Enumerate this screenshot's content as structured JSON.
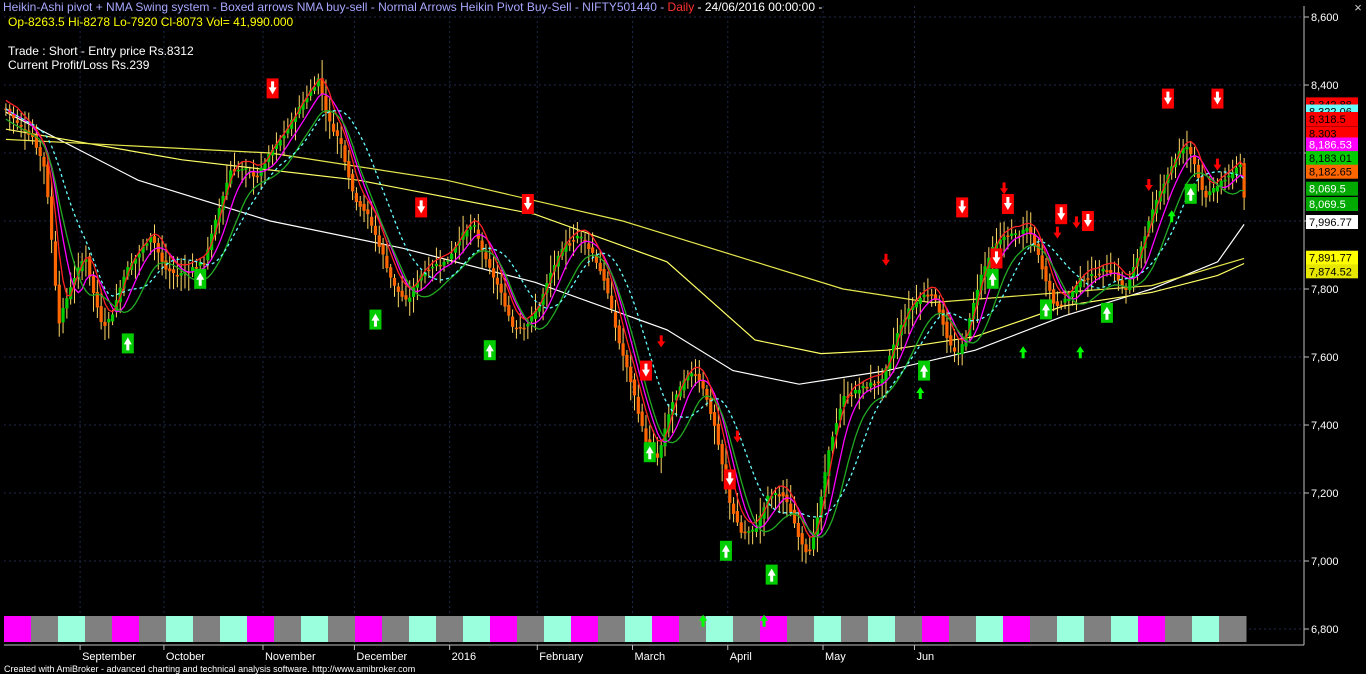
{
  "title": {
    "text": "Heikin-Ashi pivot + NMA Swing system - Boxed arrows NMA buy-sell - Normal Arrows Heikin Pivot Buy-Sell - NIFTY501440 - ",
    "interval": "Daily",
    "timestamp": " - 24/06/2016 00:00:00 -"
  },
  "ohlc_line": "Op-8263.5  Hi-8278  Lo-7920  Cl-8073  Vol= 41,990.000",
  "trade_line": "Trade : Short - Entry price Rs.8312",
  "profit_line": "Current Profit/Loss Rs.239",
  "credit": "Created with AmiBroker - advanced charting and technical analysis software. http://www.amibroker.com",
  "close_icon": "×",
  "colors": {
    "background": "#000000",
    "grid": "#1e2a4a",
    "axis_text": "#ffffff",
    "candle_up": "#00cc00",
    "candle_down": "#ff6600",
    "sell_arrow": "#ff0000",
    "buy_arrow": "#00ff00",
    "ribbon_pink": "#ff00ff",
    "ribbon_mint": "#99ffdd",
    "ribbon_gray": "#808080"
  },
  "chart_data": {
    "type": "candlestick",
    "symbol": "NIFTY501440",
    "interval": "Daily",
    "y_ticks": [
      6800,
      7000,
      7200,
      7400,
      7600,
      7800,
      8000,
      8200,
      8400,
      8600
    ],
    "y_tick_labels": [
      "6,800",
      "7,000",
      "7,200",
      "7,400",
      "7,600",
      "7,800",
      "8,000",
      "8,200",
      "8,400",
      "8,600"
    ],
    "ylim": [
      6760,
      8640
    ],
    "x_months": [
      "September",
      "October",
      "November",
      "December",
      "2016",
      "February",
      "March",
      "April",
      "May",
      "Jun"
    ],
    "price_path": [
      [
        0,
        8330
      ],
      [
        3,
        8280
      ],
      [
        6,
        8250
      ],
      [
        9,
        8150
      ],
      [
        12,
        7700
      ],
      [
        15,
        7820
      ],
      [
        18,
        7900
      ],
      [
        20,
        7780
      ],
      [
        22,
        7690
      ],
      [
        24,
        7720
      ],
      [
        27,
        7850
      ],
      [
        30,
        7900
      ],
      [
        33,
        7960
      ],
      [
        36,
        7860
      ],
      [
        39,
        7840
      ],
      [
        42,
        7860
      ],
      [
        45,
        7880
      ],
      [
        48,
        8020
      ],
      [
        51,
        8150
      ],
      [
        54,
        8150
      ],
      [
        57,
        8130
      ],
      [
        60,
        8200
      ],
      [
        63,
        8250
      ],
      [
        66,
        8320
      ],
      [
        69,
        8380
      ],
      [
        71,
        8420
      ],
      [
        73,
        8300
      ],
      [
        76,
        8230
      ],
      [
        79,
        8070
      ],
      [
        82,
        8020
      ],
      [
        85,
        7920
      ],
      [
        88,
        7810
      ],
      [
        91,
        7760
      ],
      [
        94,
        7840
      ],
      [
        97,
        7870
      ],
      [
        100,
        7880
      ],
      [
        103,
        7950
      ],
      [
        106,
        7990
      ],
      [
        109,
        7880
      ],
      [
        112,
        7800
      ],
      [
        115,
        7690
      ],
      [
        118,
        7690
      ],
      [
        121,
        7750
      ],
      [
        124,
        7860
      ],
      [
        127,
        7930
      ],
      [
        130,
        7960
      ],
      [
        133,
        7910
      ],
      [
        136,
        7820
      ],
      [
        139,
        7650
      ],
      [
        142,
        7520
      ],
      [
        145,
        7360
      ],
      [
        148,
        7300
      ],
      [
        151,
        7460
      ],
      [
        154,
        7530
      ],
      [
        156,
        7560
      ],
      [
        158,
        7520
      ],
      [
        161,
        7390
      ],
      [
        164,
        7180
      ],
      [
        167,
        7080
      ],
      [
        170,
        7090
      ],
      [
        173,
        7190
      ],
      [
        176,
        7200
      ],
      [
        178,
        7150
      ],
      [
        180,
        7070
      ],
      [
        182,
        7020
      ],
      [
        184,
        7110
      ],
      [
        187,
        7340
      ],
      [
        190,
        7480
      ],
      [
        193,
        7500
      ],
      [
        196,
        7520
      ],
      [
        199,
        7530
      ],
      [
        202,
        7660
      ],
      [
        205,
        7740
      ],
      [
        208,
        7780
      ],
      [
        210,
        7790
      ],
      [
        212,
        7730
      ],
      [
        214,
        7640
      ],
      [
        216,
        7600
      ],
      [
        218,
        7670
      ],
      [
        221,
        7830
      ],
      [
        224,
        7920
      ],
      [
        227,
        7960
      ],
      [
        230,
        7960
      ],
      [
        232,
        7980
      ],
      [
        234,
        7910
      ],
      [
        236,
        7830
      ],
      [
        238,
        7750
      ],
      [
        241,
        7770
      ],
      [
        244,
        7830
      ],
      [
        247,
        7840
      ],
      [
        250,
        7860
      ],
      [
        252,
        7840
      ],
      [
        254,
        7790
      ],
      [
        257,
        7900
      ],
      [
        260,
        8020
      ],
      [
        263,
        8120
      ],
      [
        266,
        8200
      ],
      [
        268,
        8220
      ],
      [
        270,
        8160
      ],
      [
        272,
        8070
      ],
      [
        274,
        8090
      ],
      [
        276,
        8120
      ],
      [
        278,
        8130
      ],
      [
        280,
        8180
      ],
      [
        281,
        8073
      ]
    ],
    "emas": [
      {
        "color": "#ffffff",
        "points": [
          [
            0,
            8320
          ],
          [
            30,
            8120
          ],
          [
            60,
            8000
          ],
          [
            90,
            7920
          ],
          [
            120,
            7820
          ],
          [
            150,
            7680
          ],
          [
            165,
            7560
          ],
          [
            180,
            7520
          ],
          [
            200,
            7560
          ],
          [
            220,
            7620
          ],
          [
            240,
            7720
          ],
          [
            260,
            7800
          ],
          [
            275,
            7880
          ],
          [
            281,
            7990
          ]
        ]
      },
      {
        "color": "#ffff66",
        "points": [
          [
            0,
            8270
          ],
          [
            40,
            8180
          ],
          [
            80,
            8120
          ],
          [
            120,
            8020
          ],
          [
            150,
            7880
          ],
          [
            170,
            7650
          ],
          [
            185,
            7610
          ],
          [
            200,
            7620
          ],
          [
            220,
            7660
          ],
          [
            240,
            7750
          ],
          [
            260,
            7790
          ],
          [
            275,
            7840
          ],
          [
            281,
            7875
          ]
        ]
      },
      {
        "color": "#e6e64d",
        "points": [
          [
            0,
            8240
          ],
          [
            60,
            8200
          ],
          [
            100,
            8120
          ],
          [
            140,
            8000
          ],
          [
            170,
            7880
          ],
          [
            190,
            7800
          ],
          [
            210,
            7760
          ],
          [
            240,
            7790
          ],
          [
            260,
            7810
          ],
          [
            281,
            7890
          ]
        ]
      }
    ],
    "right_labels": [
      {
        "value": "8,342.88",
        "price": 8343,
        "bg": "#ff0000",
        "fg": "#000000"
      },
      {
        "value": "8,322.06",
        "price": 8322,
        "bg": "#66ffff",
        "fg": "#000000"
      },
      {
        "value": "8,318.5",
        "price": 8300,
        "bg": "#ff0000",
        "fg": "#000000"
      },
      {
        "value": "8,303",
        "price": 8258,
        "bg": "#ff0000",
        "fg": "#000000"
      },
      {
        "value": "8,186.53",
        "price": 8225,
        "bg": "#ff00ff",
        "fg": "#ffffff"
      },
      {
        "value": "8,183.01",
        "price": 8185,
        "bg": "#00cc00",
        "fg": "#000000"
      },
      {
        "value": "8,182.65",
        "price": 8145,
        "bg": "#ff6600",
        "fg": "#000000"
      },
      {
        "value": "8,069.5",
        "price": 8095,
        "bg": "#00aa00",
        "fg": "#ffffff"
      },
      {
        "value": "8,069.5",
        "price": 8050,
        "bg": "#00aa00",
        "fg": "#ffffff"
      },
      {
        "value": "7,996.77",
        "price": 7997,
        "bg": "#ffffff",
        "fg": "#000000"
      },
      {
        "value": "7,891.77",
        "price": 7892,
        "bg": "#ffff00",
        "fg": "#000000"
      },
      {
        "value": "7,874.52",
        "price": 7852,
        "bg": "#e6e600",
        "fg": "#000000"
      }
    ],
    "sell_boxed": [
      [
        70,
        8390
      ],
      [
        109,
        8040
      ],
      [
        137,
        8050
      ],
      [
        168,
        7560
      ],
      [
        190,
        7240
      ],
      [
        251,
        8040
      ],
      [
        260,
        7890
      ],
      [
        263,
        8050
      ],
      [
        277,
        8020
      ],
      [
        284,
        8000
      ],
      [
        305,
        8360
      ],
      [
        318,
        8360
      ]
    ],
    "buy_boxed": [
      [
        32,
        7640
      ],
      [
        51,
        7830
      ],
      [
        97,
        7710
      ],
      [
        127,
        7620
      ],
      [
        169,
        7320
      ],
      [
        189,
        7030
      ],
      [
        201,
        6960
      ],
      [
        241,
        7560
      ],
      [
        259,
        7830
      ],
      [
        273,
        7740
      ],
      [
        289,
        7730
      ],
      [
        311,
        8080
      ]
    ],
    "sell_plain": [
      [
        172,
        7640
      ],
      [
        192,
        7360
      ],
      [
        231,
        7880
      ],
      [
        262,
        8090
      ],
      [
        281,
        7990
      ],
      [
        276,
        7960
      ],
      [
        300,
        8100
      ],
      [
        318,
        8160
      ]
    ],
    "buy_plain": [
      [
        183,
        6830
      ],
      [
        199,
        6830
      ],
      [
        240,
        7500
      ],
      [
        267,
        7620
      ],
      [
        282,
        7620
      ],
      [
        306,
        8020
      ]
    ],
    "ribbon": [
      "pink",
      "gray",
      "mint",
      "gray",
      "pink",
      "gray",
      "mint",
      "gray",
      "mint",
      "pink",
      "gray",
      "mint",
      "gray",
      "pink",
      "gray",
      "mint",
      "gray",
      "mint",
      "pink",
      "gray",
      "mint",
      "pink",
      "gray",
      "mint",
      "pink",
      "gray",
      "mint",
      "gray",
      "pink",
      "gray",
      "mint",
      "gray",
      "mint",
      "gray",
      "pink",
      "gray",
      "mint",
      "pink",
      "gray",
      "mint",
      "gray",
      "mint",
      "pink",
      "gray",
      "mint",
      "gray"
    ]
  }
}
